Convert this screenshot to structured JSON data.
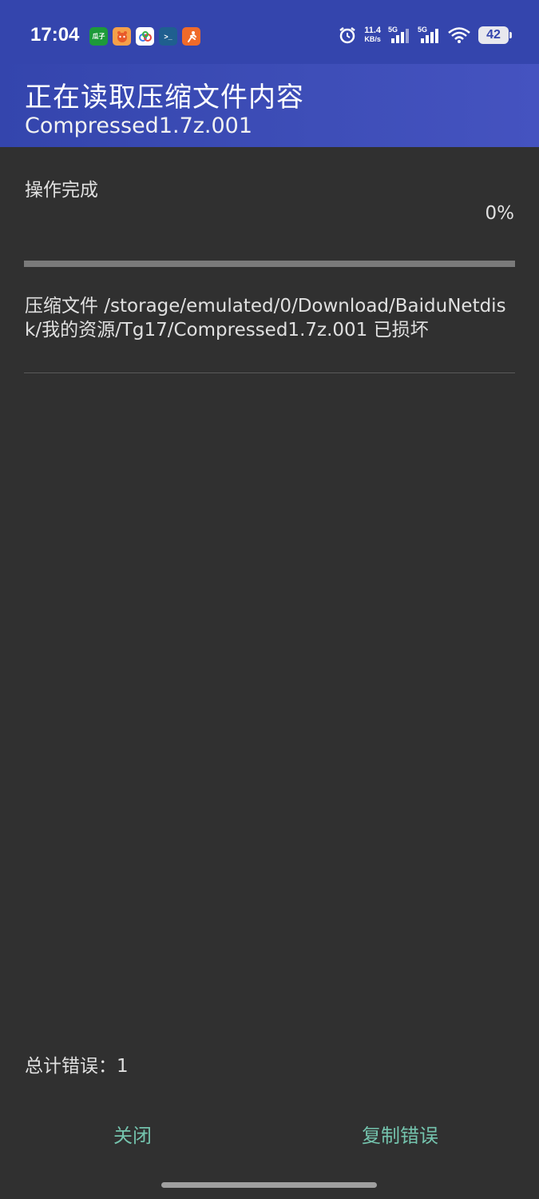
{
  "status_bar": {
    "time": "17:04",
    "app_icons": [
      {
        "name": "guazi-app-icon",
        "label": "瓜子",
        "bg": "#1d9a3a"
      },
      {
        "name": "pet-app-icon",
        "label": "",
        "bg": "#f5a04a"
      },
      {
        "name": "cloud-app-icon",
        "label": "",
        "bg": "#ffffff"
      },
      {
        "name": "terminal-app-icon",
        "label": ">_",
        "bg": "#1f5f8f"
      },
      {
        "name": "runner-app-icon",
        "label": "",
        "bg": "#f06a2a"
      }
    ],
    "net_speed_value": "11.4",
    "net_speed_unit": "KB/s",
    "signal_1_label": "5G",
    "signal_2_label": "5G",
    "battery": "42"
  },
  "header": {
    "title": "正在读取压缩文件内容",
    "subtitle": "Compressed1.7z.001"
  },
  "progress": {
    "status_text": "操作完成",
    "percent_text": "0%",
    "value": 0
  },
  "errors": {
    "message": "压缩文件 /storage/emulated/0/Download/BaiduNetdisk/我的资源/Tg17/Compressed1.7z.001 已损坏",
    "total_label": "总计错误：1"
  },
  "actions": {
    "close_label": "关闭",
    "copy_label": "复制错误"
  },
  "colors": {
    "accent": "#3445ad",
    "button_text": "#74c3ad",
    "background": "#303030"
  }
}
